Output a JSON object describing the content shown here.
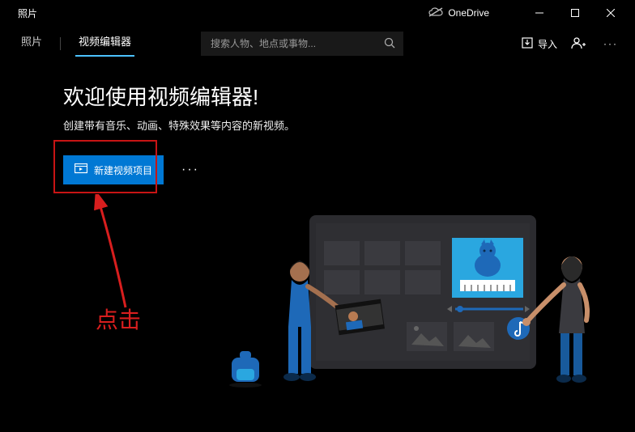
{
  "titlebar": {
    "title": "照片"
  },
  "onedrive": {
    "label": "OneDrive"
  },
  "tabs": {
    "photos": "照片",
    "video_editor": "视频编辑器"
  },
  "search": {
    "placeholder": "搜索人物、地点或事物..."
  },
  "header_actions": {
    "import": "导入"
  },
  "main": {
    "welcome": "欢迎使用视频编辑器!",
    "subtitle": "创建带有音乐、动画、特殊效果等内容的新视频。",
    "new_video_btn": "新建视频项目",
    "more": "···"
  },
  "annotation": {
    "label": "点击"
  }
}
